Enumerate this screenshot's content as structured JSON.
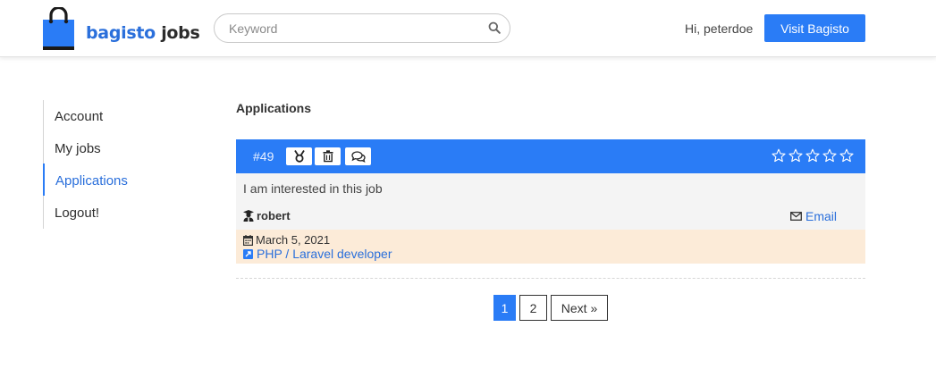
{
  "colors": {
    "primary": "#2a7cf6",
    "link": "#2a6fdb",
    "applicant_footer_bg": "#fcebd8",
    "card_body_bg": "#f4f4f4"
  },
  "header": {
    "logo": {
      "brand": "bagisto",
      "suffix": "jobs",
      "icon": "shopping-bag-icon"
    },
    "search": {
      "placeholder": "Keyword",
      "value": "",
      "icon": "search-icon"
    },
    "greeting": "Hi, peterdoe",
    "visit_button": "Visit Bagisto"
  },
  "sidebar": {
    "items": [
      {
        "label": "Account",
        "active": false
      },
      {
        "label": "My jobs",
        "active": false
      },
      {
        "label": "Applications",
        "active": true
      },
      {
        "label": "Logout!",
        "active": false
      }
    ]
  },
  "main": {
    "title": "Applications",
    "applications": [
      {
        "id": "#49",
        "actions": [
          {
            "icon": "medal-icon"
          },
          {
            "icon": "trash-icon"
          },
          {
            "icon": "comments-icon"
          }
        ],
        "rating": 0,
        "rating_max": 5,
        "message": "I am interested in this job",
        "applicant": "robert",
        "applicant_icon": "user-graduate-icon",
        "email_label": "Email",
        "date": "March 5, 2021",
        "job_title": "PHP / Laravel developer"
      }
    ]
  },
  "pagination": {
    "pages": [
      "1",
      "2"
    ],
    "current": "1",
    "next_label": "Next »"
  }
}
